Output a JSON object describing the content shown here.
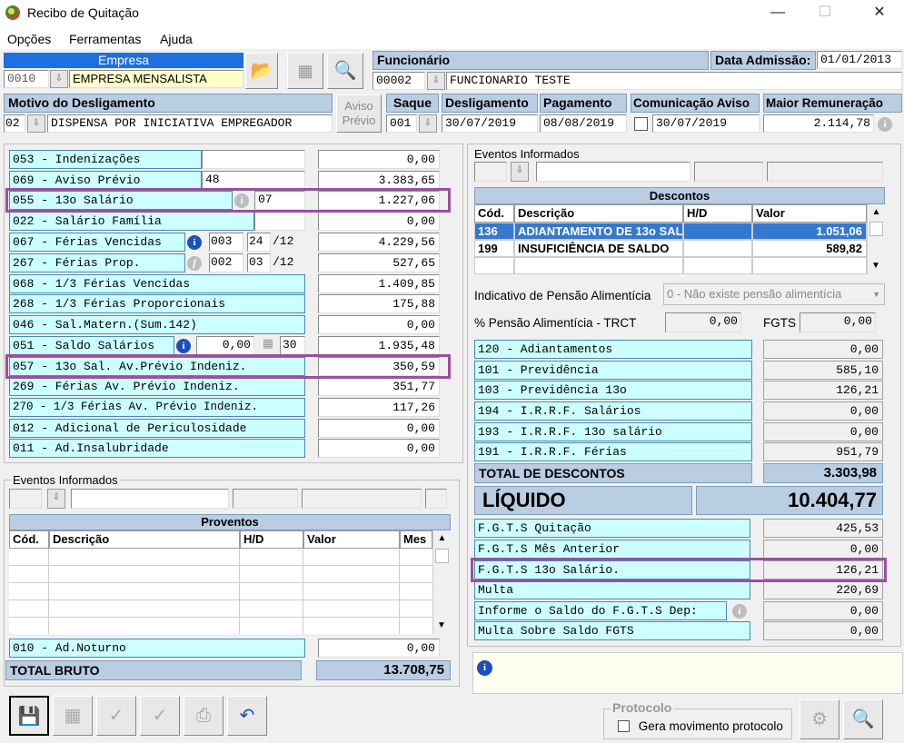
{
  "window": {
    "title": "Recibo de Quitação",
    "minimize": "—",
    "maximize": "☐",
    "close": "✕"
  },
  "menu": [
    "Opções",
    "Ferramentas",
    "Ajuda"
  ],
  "empresa": {
    "label": "Empresa",
    "code": "0010",
    "name": "EMPRESA MENSALISTA"
  },
  "funcionario": {
    "label": "Funcionário",
    "code": "00002",
    "name": "FUNCIONARIO TESTE"
  },
  "admissao": {
    "label": "Data Admissão:",
    "value": "01/01/2013"
  },
  "motivo": {
    "label": "Motivo do Desligamento",
    "code": "02",
    "name": "DISPENSA POR INICIATIVA EMPREGADOR"
  },
  "aviso_btn": {
    "line1": "Aviso",
    "line2": "Prévio"
  },
  "saque": {
    "label": "Saque",
    "value": "001"
  },
  "desligamento": {
    "label": "Desligamento",
    "value": "30/07/2019"
  },
  "pagamento": {
    "label": "Pagamento",
    "value": "08/08/2019"
  },
  "comunicacao": {
    "label": "Comunicação Aviso",
    "value": "30/07/2019"
  },
  "maior_remuneracao": {
    "label": "Maior Remuneração",
    "value": "2.114,78"
  },
  "proventos_rows": [
    {
      "label": "053 - Indenizações",
      "value": "0,00"
    },
    {
      "label": "069 - Aviso Prévio",
      "extra": "48",
      "value": "3.383,65"
    },
    {
      "label": "055 - 13o Salário",
      "extra": "07",
      "value": "1.227,06"
    },
    {
      "label": "022 - Salário Família",
      "value": "0,00"
    },
    {
      "label": "067 - Férias Vencidas",
      "extra1": "003",
      "extra2": "24",
      "extra3": "/12",
      "value": "4.229,56"
    },
    {
      "label": "267 - Férias Prop.",
      "extra1": "002",
      "extra2": "03",
      "extra3": "/12",
      "value": "527,65"
    },
    {
      "label": "068 - 1/3 Férias Vencidas",
      "value": "1.409,85"
    },
    {
      "label": "268 - 1/3 Férias Proporcionais",
      "value": "175,88"
    },
    {
      "label": "046 - Sal.Matern.(Sum.142)",
      "value": "0,00"
    },
    {
      "label": "051 - Saldo Salários",
      "extra1": "0,00",
      "extra2": "30",
      "value": "1.935,48"
    },
    {
      "label": "057 - 13o Sal. Av.Prévio Indeniz.",
      "value": "350,59"
    },
    {
      "label": "269 -  Férias  Av. Prévio Indeniz.",
      "value": "351,77"
    },
    {
      "label": "270 - 1/3 Férias Av. Prévio Indeniz.",
      "value": "117,26"
    },
    {
      "label": "012 - Adicional de Periculosidade",
      "value": "0,00"
    },
    {
      "label": "011 - Ad.Insalubridade",
      "value": "0,00"
    }
  ],
  "eventos_left": {
    "label": "Eventos Informados"
  },
  "proventos_grid": {
    "title": "Proventos",
    "cols": [
      "Cód.",
      "Descrição",
      "H/D",
      "Valor",
      "Mes"
    ]
  },
  "ad_noturno": {
    "label": "010 - Ad.Noturno",
    "value": "0,00"
  },
  "total_bruto": {
    "label": "TOTAL BRUTO",
    "value": "13.708,75"
  },
  "eventos_right": {
    "label": "Eventos Informados"
  },
  "descontos_grid": {
    "title": "Descontos",
    "cols": [
      "Cód.",
      "Descrição",
      "H/D",
      "Valor"
    ],
    "rows": [
      {
        "cod": "136",
        "desc": "ADIANTAMENTO DE 13o SAL",
        "hd": "",
        "valor": "1.051,06"
      },
      {
        "cod": "199",
        "desc": "INSUFICIÊNCIA DE SALDO",
        "hd": "",
        "valor": "589,82"
      }
    ]
  },
  "pensao": {
    "label": "Indicativo de Pensão Alimentícia",
    "value": "0 - Não existe pensão alimentícia"
  },
  "pct_pensao": {
    "label": "% Pensão Alimentícia - TRCT",
    "value": "0,00"
  },
  "fgts": {
    "label": "FGTS",
    "value": "0,00"
  },
  "descontos_rows": [
    {
      "label": "120 - Adiantamentos",
      "value": "0,00"
    },
    {
      "label": "101 - Previdência",
      "value": "585,10"
    },
    {
      "label": "103 - Previdência 13o",
      "value": "126,21"
    },
    {
      "label": "194 - I.R.R.F. Salários",
      "value": "0,00"
    },
    {
      "label": "193 - I.R.R.F. 13o salário",
      "value": "0,00"
    },
    {
      "label": "191 - I.R.R.F. Férias",
      "value": "951,79"
    }
  ],
  "total_descontos": {
    "label": "TOTAL DE DESCONTOS",
    "value": "3.303,98"
  },
  "liquido": {
    "label": "LÍQUIDO",
    "value": "10.404,77"
  },
  "fgts_rows": [
    {
      "label": "F.G.T.S  Quitação",
      "value": "425,53"
    },
    {
      "label": "F.G.T.S  Mês Anterior",
      "value": "0,00"
    },
    {
      "label": "F.G.T.S  13o Salário.",
      "value": "126,21"
    },
    {
      "label": "Multa",
      "value": "220,69"
    },
    {
      "label": "Informe o Saldo do F.G.T.S Dep:",
      "value": "0,00"
    },
    {
      "label": "Multa Sobre Saldo FGTS",
      "value": "0,00"
    }
  ],
  "protocolo": {
    "label": "Protocolo",
    "checkbox": "Gera movimento protocolo"
  },
  "colors": {
    "cyan": "#ccffff",
    "header": "#b9cde3",
    "highlight": "#9b4fa0",
    "selection": "#3478d0"
  }
}
